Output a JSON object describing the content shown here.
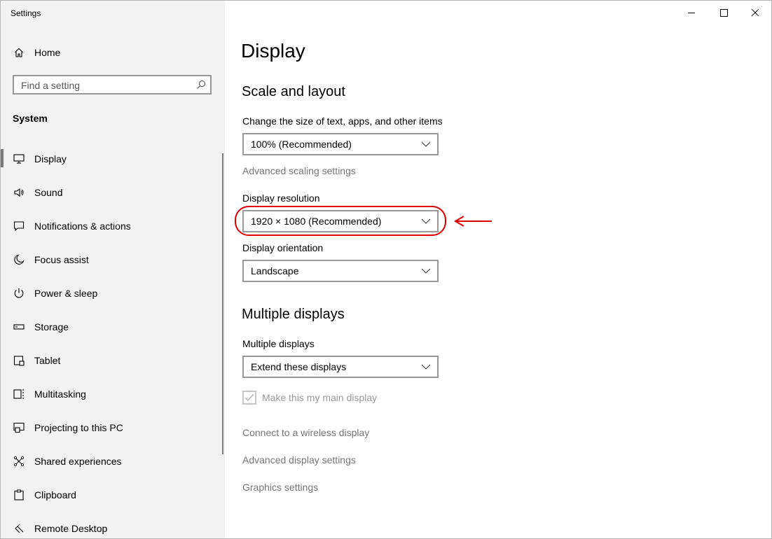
{
  "window": {
    "title": "Settings",
    "controls": [
      "minimize",
      "maximize",
      "close"
    ]
  },
  "sidebar": {
    "home_label": "Home",
    "search": {
      "placeholder": "Find a setting"
    },
    "section_label": "System",
    "items": [
      {
        "label": "Display",
        "icon": "monitor-icon",
        "selected": true
      },
      {
        "label": "Sound",
        "icon": "speaker-icon"
      },
      {
        "label": "Notifications & actions",
        "icon": "notification-icon"
      },
      {
        "label": "Focus assist",
        "icon": "moon-icon"
      },
      {
        "label": "Power & sleep",
        "icon": "power-icon"
      },
      {
        "label": "Storage",
        "icon": "storage-icon"
      },
      {
        "label": "Tablet",
        "icon": "tablet-icon"
      },
      {
        "label": "Multitasking",
        "icon": "multitasking-icon"
      },
      {
        "label": "Projecting to this PC",
        "icon": "projecting-icon"
      },
      {
        "label": "Shared experiences",
        "icon": "shared-experiences-icon"
      },
      {
        "label": "Clipboard",
        "icon": "clipboard-icon"
      },
      {
        "label": "Remote Desktop",
        "icon": "remote-desktop-icon"
      }
    ]
  },
  "main": {
    "title": "Display",
    "scale_section": {
      "heading": "Scale and layout",
      "scale_label": "Change the size of text, apps, and other items",
      "scale_value": "100% (Recommended)",
      "advanced_scaling_link": "Advanced scaling settings",
      "resolution_label": "Display resolution",
      "resolution_value": "1920 × 1080 (Recommended)",
      "orientation_label": "Display orientation",
      "orientation_value": "Landscape"
    },
    "multi_section": {
      "heading": "Multiple displays",
      "label": "Multiple displays",
      "value": "Extend these displays",
      "main_display_checkbox": {
        "label": "Make this my main display",
        "checked": true,
        "disabled": true
      },
      "links": [
        "Connect to a wireless display",
        "Advanced display settings",
        "Graphics settings"
      ]
    }
  },
  "colors": {
    "annotation": "#e00000",
    "sidebar_bg": "#f2f2f2",
    "disabled_text": "#767676"
  }
}
